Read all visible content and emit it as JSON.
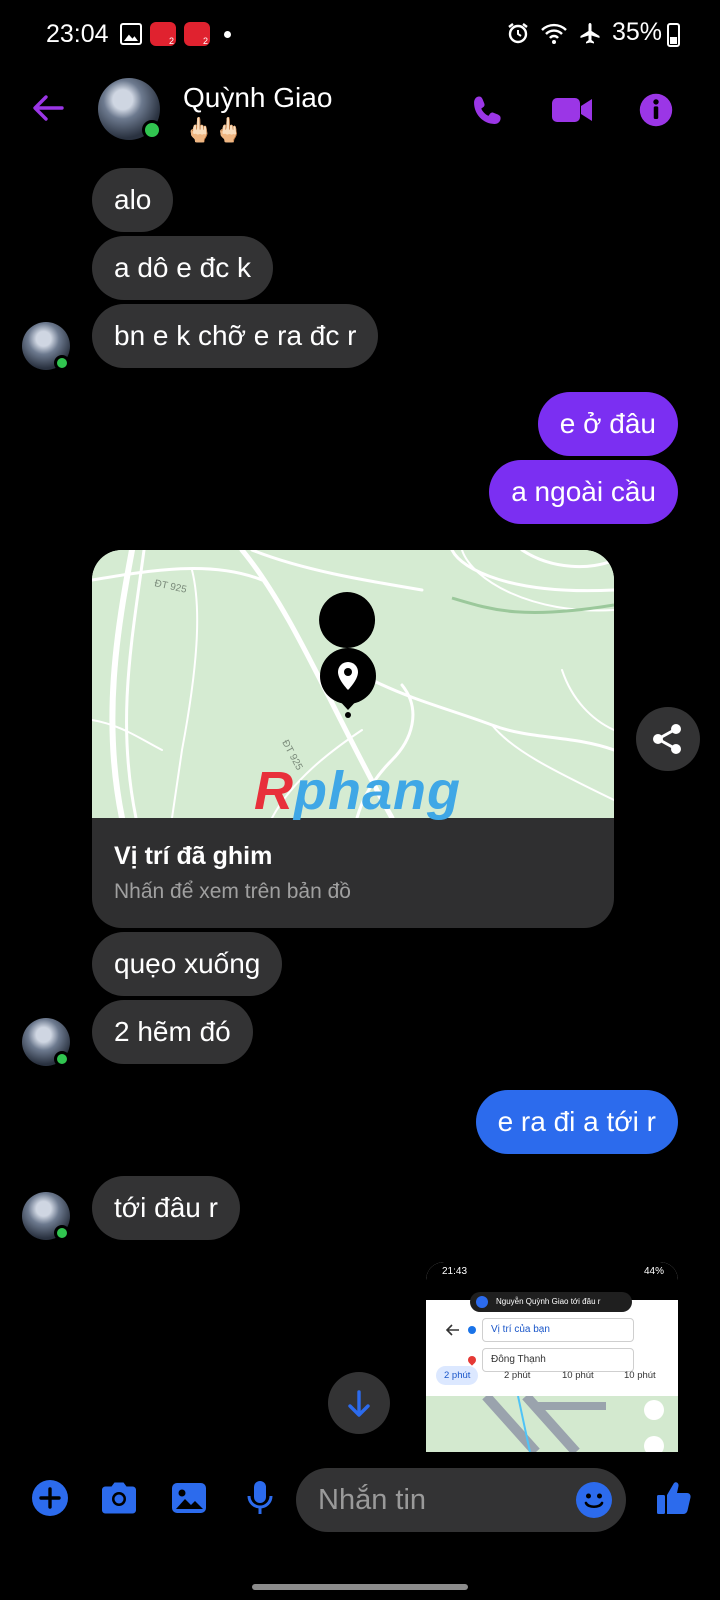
{
  "status_bar": {
    "time": "23:04",
    "battery": "35%",
    "icons": [
      "image-icon",
      "app-notification-icon",
      "app-notification-icon",
      "alarm-icon",
      "wifi-icon",
      "airplane-icon",
      "battery-icon"
    ]
  },
  "header": {
    "contact_name": "Quỳnh Giao",
    "contact_subtitle": "🖕🏻🖕🏻",
    "accent_color": "#9b36e6"
  },
  "messages": [
    {
      "side": "in",
      "text": "alo"
    },
    {
      "side": "in",
      "text": "a dô e đc k"
    },
    {
      "side": "in",
      "text": "bn e k chỡ e ra đc r"
    },
    {
      "side": "out",
      "text": "e ở đâu"
    },
    {
      "side": "out",
      "text": "a ngoài cầu"
    },
    {
      "side": "in",
      "text": "quẹo xuống"
    },
    {
      "side": "in",
      "text": "2 hẽm đó"
    },
    {
      "side": "out",
      "text": "e ra đi a tới r"
    },
    {
      "side": "in",
      "text": "tới đâu r"
    }
  ],
  "location_card": {
    "title": "Vị trí đã ghim",
    "subtitle": "Nhấn để xem trên bản đồ",
    "road_labels": [
      "ĐT 925",
      "ĐT 925"
    ],
    "watermark": {
      "r": "R",
      "rest": "phang"
    }
  },
  "screenshot_thumb": {
    "time": "21:43",
    "battery": "44%",
    "banner": "Nguyễn Quỳnh Giao tới đâu r",
    "from_field": "Vị trí của bạn",
    "to_field": "Đông Thạnh",
    "modes": [
      "2 phút",
      "2 phút",
      "10 phút",
      "10 phút"
    ]
  },
  "composer": {
    "placeholder": "Nhắn tin"
  },
  "colors": {
    "outgoing_purple": "#7b2ff2",
    "outgoing_blue": "#2c6bed",
    "incoming": "#333334",
    "online": "#31c550"
  }
}
